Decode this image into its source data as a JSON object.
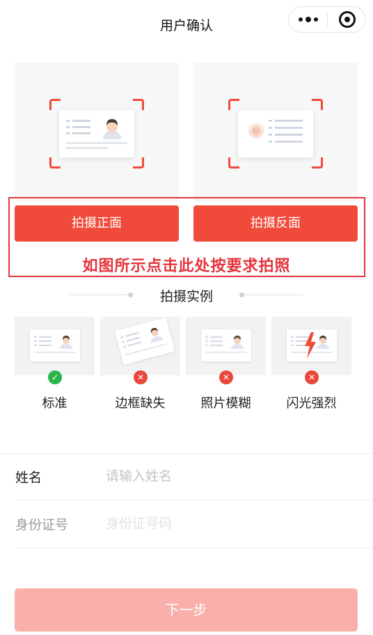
{
  "header": {
    "title": "用户确认"
  },
  "id_capture": {
    "front_button": "拍摄正面",
    "back_button": "拍摄反面",
    "annotation": "如图所示点击此处按要求拍照"
  },
  "examples": {
    "section_title": "拍摄实例",
    "items": [
      {
        "label": "标准",
        "status": "ok"
      },
      {
        "label": "边框缺失",
        "status": "error"
      },
      {
        "label": "照片模糊",
        "status": "error"
      },
      {
        "label": "闪光强烈",
        "status": "error"
      }
    ]
  },
  "form": {
    "name_label": "姓名",
    "name_placeholder": "请输入姓名",
    "id_label": "身份证号",
    "id_placeholder": "身份证号码"
  },
  "next_button": "下一步",
  "colors": {
    "accent": "#f04a3a",
    "annotation_red": "#e4333b",
    "ok_green": "#2bb64c",
    "error_red": "#e9473c",
    "next_disabled": "#f9b0aa"
  }
}
